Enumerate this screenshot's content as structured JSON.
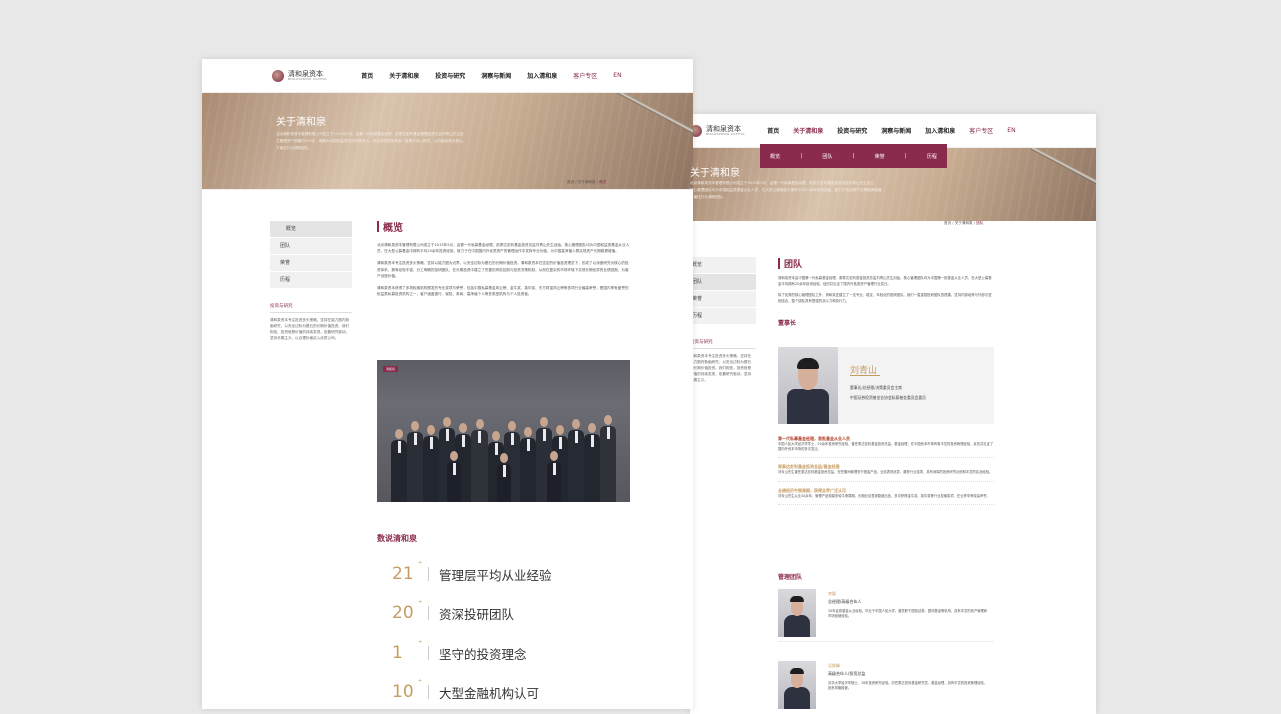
{
  "brand": {
    "name_cn": "清和泉资本",
    "name_en": "BINLOSPRING CAPITAL"
  },
  "nav": {
    "items": [
      "首页",
      "关于清和泉",
      "投资与研究",
      "洞察与新闻",
      "加入清和泉"
    ],
    "client": "客户专区",
    "lang": "EN"
  },
  "page1": {
    "banner_title": "关于清和泉",
    "banner_text": [
      "北京清和泉资本管理有限公司成立于2015年5月，由第一代私募基金经理、前泰达宏利基金管理投资总监刘青山先生创",
      "立管理资产规模约200亿，明确为中国权益类的标杆投资人。北京领先的投资者一直基于深入研究，以价值投资为核心。",
      "下最佳行业调研团队。"
    ],
    "breadcrumb": [
      "首页",
      "关于清和泉",
      "概览"
    ],
    "side_items": [
      "概览",
      "团队",
      "荣誉",
      "历程"
    ],
    "side_heading": "投资与研究",
    "side_text": "清和泉资本专注投资多头策略，坚持在能力圈内勤勉研究，以安全边际为基石的长期价值投资。我们相信，投资就是价值的持续发现，依靠研究驱动，坚持长期主义，以合理价格买入优质公司。",
    "title": "概览",
    "paragraphs": [
      "北京清和泉资本管理有限公司成立于2015年5月，由第一代私募基金经理、前泰达宏利基金投资总监刘青山先生创始。核心管理团队均为中国权益类基金从业人员，在大型公募基金中拥有平均20余年投资经验，致力于在中国国内外优质资产的管理运作中发挥专业价值，为中国高净值人群实现资产长期稳健增值。",
      "清和泉资本专注投资多头策略，坚持以能力圈为边界、以安全边际为基石的长期价值投资。清和泉资本在坚定的价值投资理念下，形成了以深度研究为核心的投资体系，拥有经验丰富、分工明确的投研团队，在长期投资中建立了完善的风险控制与投资决策机制，从而在复杂的市场环境下实现长期优异的业绩回报，为客户创造价值。",
      "清和泉资本获得了多项权威机构颁发的专业奖项与荣誉，包括中国私募基金风云榜、金牛奖、英华奖、东方财富风云榜等多项行业最高荣誉，是国内享有盛誉的权益类私募投资机构之一，客户涵盖银行、保险、券商、高净值个人等多类型机构与个人投资者。"
    ],
    "photo_tag": "清和泉",
    "subheading": "数说清和泉",
    "stats": [
      {
        "num": "21",
        "plus": "+",
        "label": "管理层平均从业经验"
      },
      {
        "num": "20",
        "plus": "+",
        "label": "资深投研团队"
      },
      {
        "num": "1",
        "plus": "+",
        "label": "坚守的投资理念"
      },
      {
        "num": "10",
        "plus": "+",
        "label": "大型金融机构认可"
      }
    ]
  },
  "page2": {
    "banner_title": "关于清和泉",
    "banner_text": [
      "北京清和泉资本管理有限公司成立于2015年5月，由第一代私募基金经理、前泰达宏利基金投资总监刘青山先生创立，",
      "核心管理团队均为中国权益类基金从业人员，在大型公募基金中拥有平均20余年投资经验，致力于实现资产长期稳健增值。",
      "下最佳行业调研团队。"
    ],
    "dropdown": [
      "概览",
      "团队",
      "荣誉",
      "历程"
    ],
    "breadcrumb": [
      "首页",
      "关于清和泉",
      "团队"
    ],
    "side_items": [
      "概览",
      "团队",
      "荣誉",
      "历程"
    ],
    "side_heading": "投资与研究",
    "side_text": "清和泉资本专注投资多头策略，坚持在能力圈内勤勉研究，以安全边际为基石的长期价值投资。我们相信，投资就是价值的持续发现，依靠研究驱动，坚持长期主义。",
    "title": "团队",
    "intro": [
      "清和泉资本由中国第一代私募基金经理、原泰达宏利基金投资总监刘青山先生创始。核心管理团队均为中国第一批基金从业人员，在大型公募基金平均拥有20余年投资经验，经历并见证了国内外各类资产管理行业变迁。",
      "除了优秀的核心管理团队之外，清和泉还建立了一支专业、稳定、年轻化的投研团队。我们一直重视投研团队的搭建，坚持内部培养与外部引进相结合，整个团队具有很强的战斗力和执行力。"
    ],
    "chair_heading": "董事长",
    "chair": {
      "name": "刘青山",
      "title1": "董事长/总经理/决策委员会主席",
      "title2": "中国证券投资基金业协会私募基金委员会委员"
    },
    "highlights": [
      {
        "h": "第一代私募基金经理，首批基金从业人员",
        "t": "中国人民大学经济学学士，20余年投资研究经验，曾任泰达宏利基金投资总监、基金经理，在中国资本市场有着丰富的投资管理经验，亲历并见证了国内外资本市场的多次变迁。"
      },
      {
        "h": "原泰达宏利基金投资总监/基金经理",
        "t": "刘青山先生曾任泰达宏利基金投资总监，在任期间管理多只基金产品，业绩表现优异，屡获行业奖项，具有深厚的投资研究功底和丰富的实战经验。"
      },
      {
        "h": "业绩经历牛熊周期，获得业界广泛认可",
        "t": "刘青山先生从业20余年，管理产品穿越多轮牛熊周期，长期业绩表现稳健出色，多次获得金牛奖、英华奖等行业权威奖项，在业界享有较高声誉。"
      }
    ],
    "mgmt_heading": "管理团队",
    "members": [
      {
        "name": "李颖",
        "role": "总经理/高级合伙人",
        "desc": "20年证券基金从业经验。毕业于中国人民大学，曾供职于国信证券、银河基金等机构，具有丰富的资产管理和市场营销经验。"
      },
      {
        "name": "吴俊峰",
        "role": "高级合伙人/投资总监",
        "desc": "清华大学经济学硕士，18年投资研究经验。历任泰达宏利基金研究员、基金经理，具有丰富的投资管理经验，投资风格稳健。"
      }
    ]
  }
}
